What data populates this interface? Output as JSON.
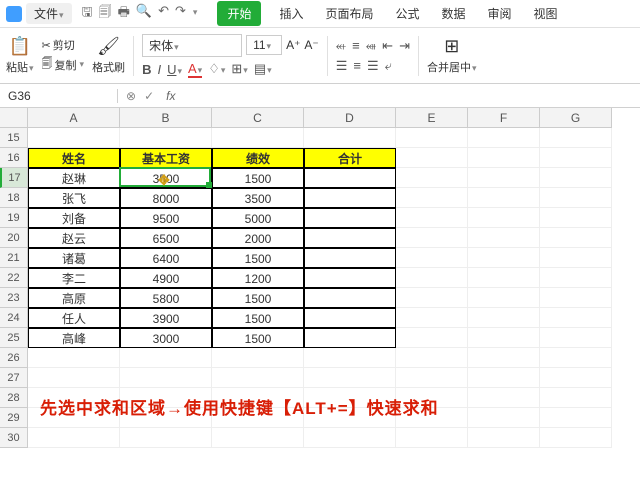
{
  "menubar": {
    "file": "文件",
    "tabs": [
      "开始",
      "插入",
      "页面布局",
      "公式",
      "数据",
      "审阅",
      "视图"
    ],
    "active_tab": 0
  },
  "ribbon": {
    "paste": "粘贴",
    "cut": "剪切",
    "copy": "复制",
    "format_painter": "格式刷",
    "font_name": "宋体",
    "font_size": "11",
    "merge": "合并居中"
  },
  "formula_bar": {
    "namebox": "G36"
  },
  "columns": [
    "A",
    "B",
    "C",
    "D",
    "E",
    "F",
    "G"
  ],
  "table": {
    "headers": [
      "姓名",
      "基本工资",
      "绩效",
      "合计"
    ],
    "rows": [
      {
        "name": "赵琳",
        "base": "3500",
        "perf": "1500"
      },
      {
        "name": "张飞",
        "base": "8000",
        "perf": "3500"
      },
      {
        "name": "刘备",
        "base": "9500",
        "perf": "5000"
      },
      {
        "name": "赵云",
        "base": "6500",
        "perf": "2000"
      },
      {
        "name": "诸葛",
        "base": "6400",
        "perf": "1500"
      },
      {
        "name": "李二",
        "base": "4900",
        "perf": "1200"
      },
      {
        "name": "高原",
        "base": "5800",
        "perf": "1500"
      },
      {
        "name": "任人",
        "base": "3900",
        "perf": "1500"
      },
      {
        "name": "高峰",
        "base": "3000",
        "perf": "1500"
      }
    ]
  },
  "row_start": 15,
  "row_end": 30,
  "active_row": 17,
  "tip": "先选中求和区域→使用快捷键【ALT+=】快速求和",
  "chart_data": {
    "type": "table",
    "title": "",
    "columns": [
      "姓名",
      "基本工资",
      "绩效",
      "合计"
    ],
    "rows": [
      [
        "赵琳",
        3500,
        1500,
        null
      ],
      [
        "张飞",
        8000,
        3500,
        null
      ],
      [
        "刘备",
        9500,
        5000,
        null
      ],
      [
        "赵云",
        6500,
        2000,
        null
      ],
      [
        "诸葛",
        6400,
        1500,
        null
      ],
      [
        "李二",
        4900,
        1200,
        null
      ],
      [
        "高原",
        5800,
        1500,
        null
      ],
      [
        "任人",
        3900,
        1500,
        null
      ],
      [
        "高峰",
        3000,
        1500,
        null
      ]
    ]
  }
}
